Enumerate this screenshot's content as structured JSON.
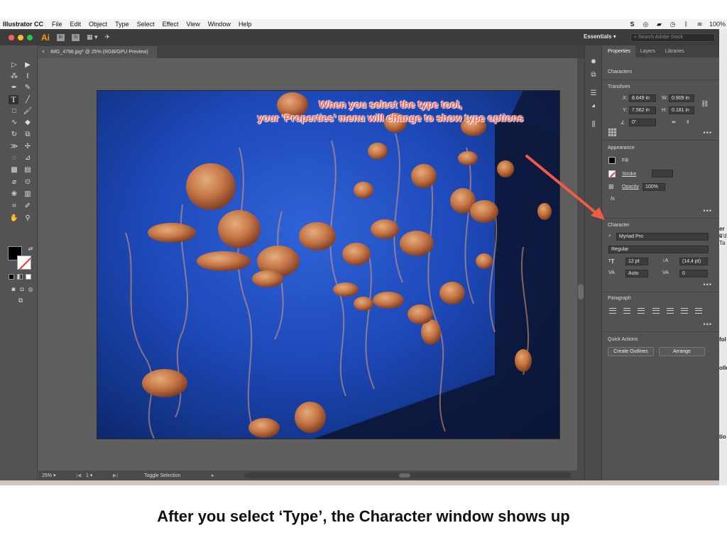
{
  "menubar": {
    "app_name": "Illustrator CC",
    "items": [
      "File",
      "Edit",
      "Object",
      "Type",
      "Select",
      "Effect",
      "View",
      "Window",
      "Help"
    ],
    "battery": "100%"
  },
  "app_bar": {
    "logo": "Ai",
    "br": "Br",
    "st": "St",
    "workspace": "Essentials",
    "search_placeholder": "Search Adobe Stock"
  },
  "document": {
    "tab_title": "IMG_4798.jpg* @ 25% (RGB/GPU Preview)",
    "tab_close": "×"
  },
  "statusbar": {
    "zoom": "25%",
    "page": "1",
    "toggle": "Toggle Selection"
  },
  "properties": {
    "tabs": [
      "Properties",
      "Layers",
      "Libraries"
    ],
    "object_type": "Characters",
    "transform": {
      "title": "Transform",
      "x_label": "X:",
      "x_value": "8.649 in",
      "y_label": "Y:",
      "y_value": "7.562 in",
      "w_label": "W:",
      "w_value": "0.909 in",
      "h_label": "H:",
      "h_value": "0.181 in",
      "rotate_value": "0°"
    },
    "appearance": {
      "title": "Appearance",
      "fill": "Fill",
      "stroke": "Stroke",
      "opacity_label": "Opacity",
      "opacity_value": "100%",
      "fx": "fx."
    },
    "character": {
      "title": "Character",
      "font": "Myriad Pro",
      "style": "Regular",
      "size": "12 pt",
      "leading": "(14.4 pt)",
      "kerning": "Auto",
      "tracking": "0"
    },
    "paragraph": {
      "title": "Paragraph"
    },
    "quick_actions": {
      "title": "Quick Actions",
      "create_outlines": "Create Outlines",
      "arrange": "Arrange"
    }
  },
  "annotation": {
    "line1": "When you select the type tool,",
    "line2": "your ‘Properties’ menu will change to show type options"
  },
  "caption": "After you select ‘Type’, the Character window shows up",
  "right_fragments": [
    "er c",
    "u'd",
    "Ta",
    "fol",
    "olle",
    "tio"
  ],
  "colors": {
    "accent_red": "#ff5e4a",
    "panel_bg": "#535353",
    "artboard_blue": "#1d48b8",
    "jelly_orange": "#e0894a"
  }
}
